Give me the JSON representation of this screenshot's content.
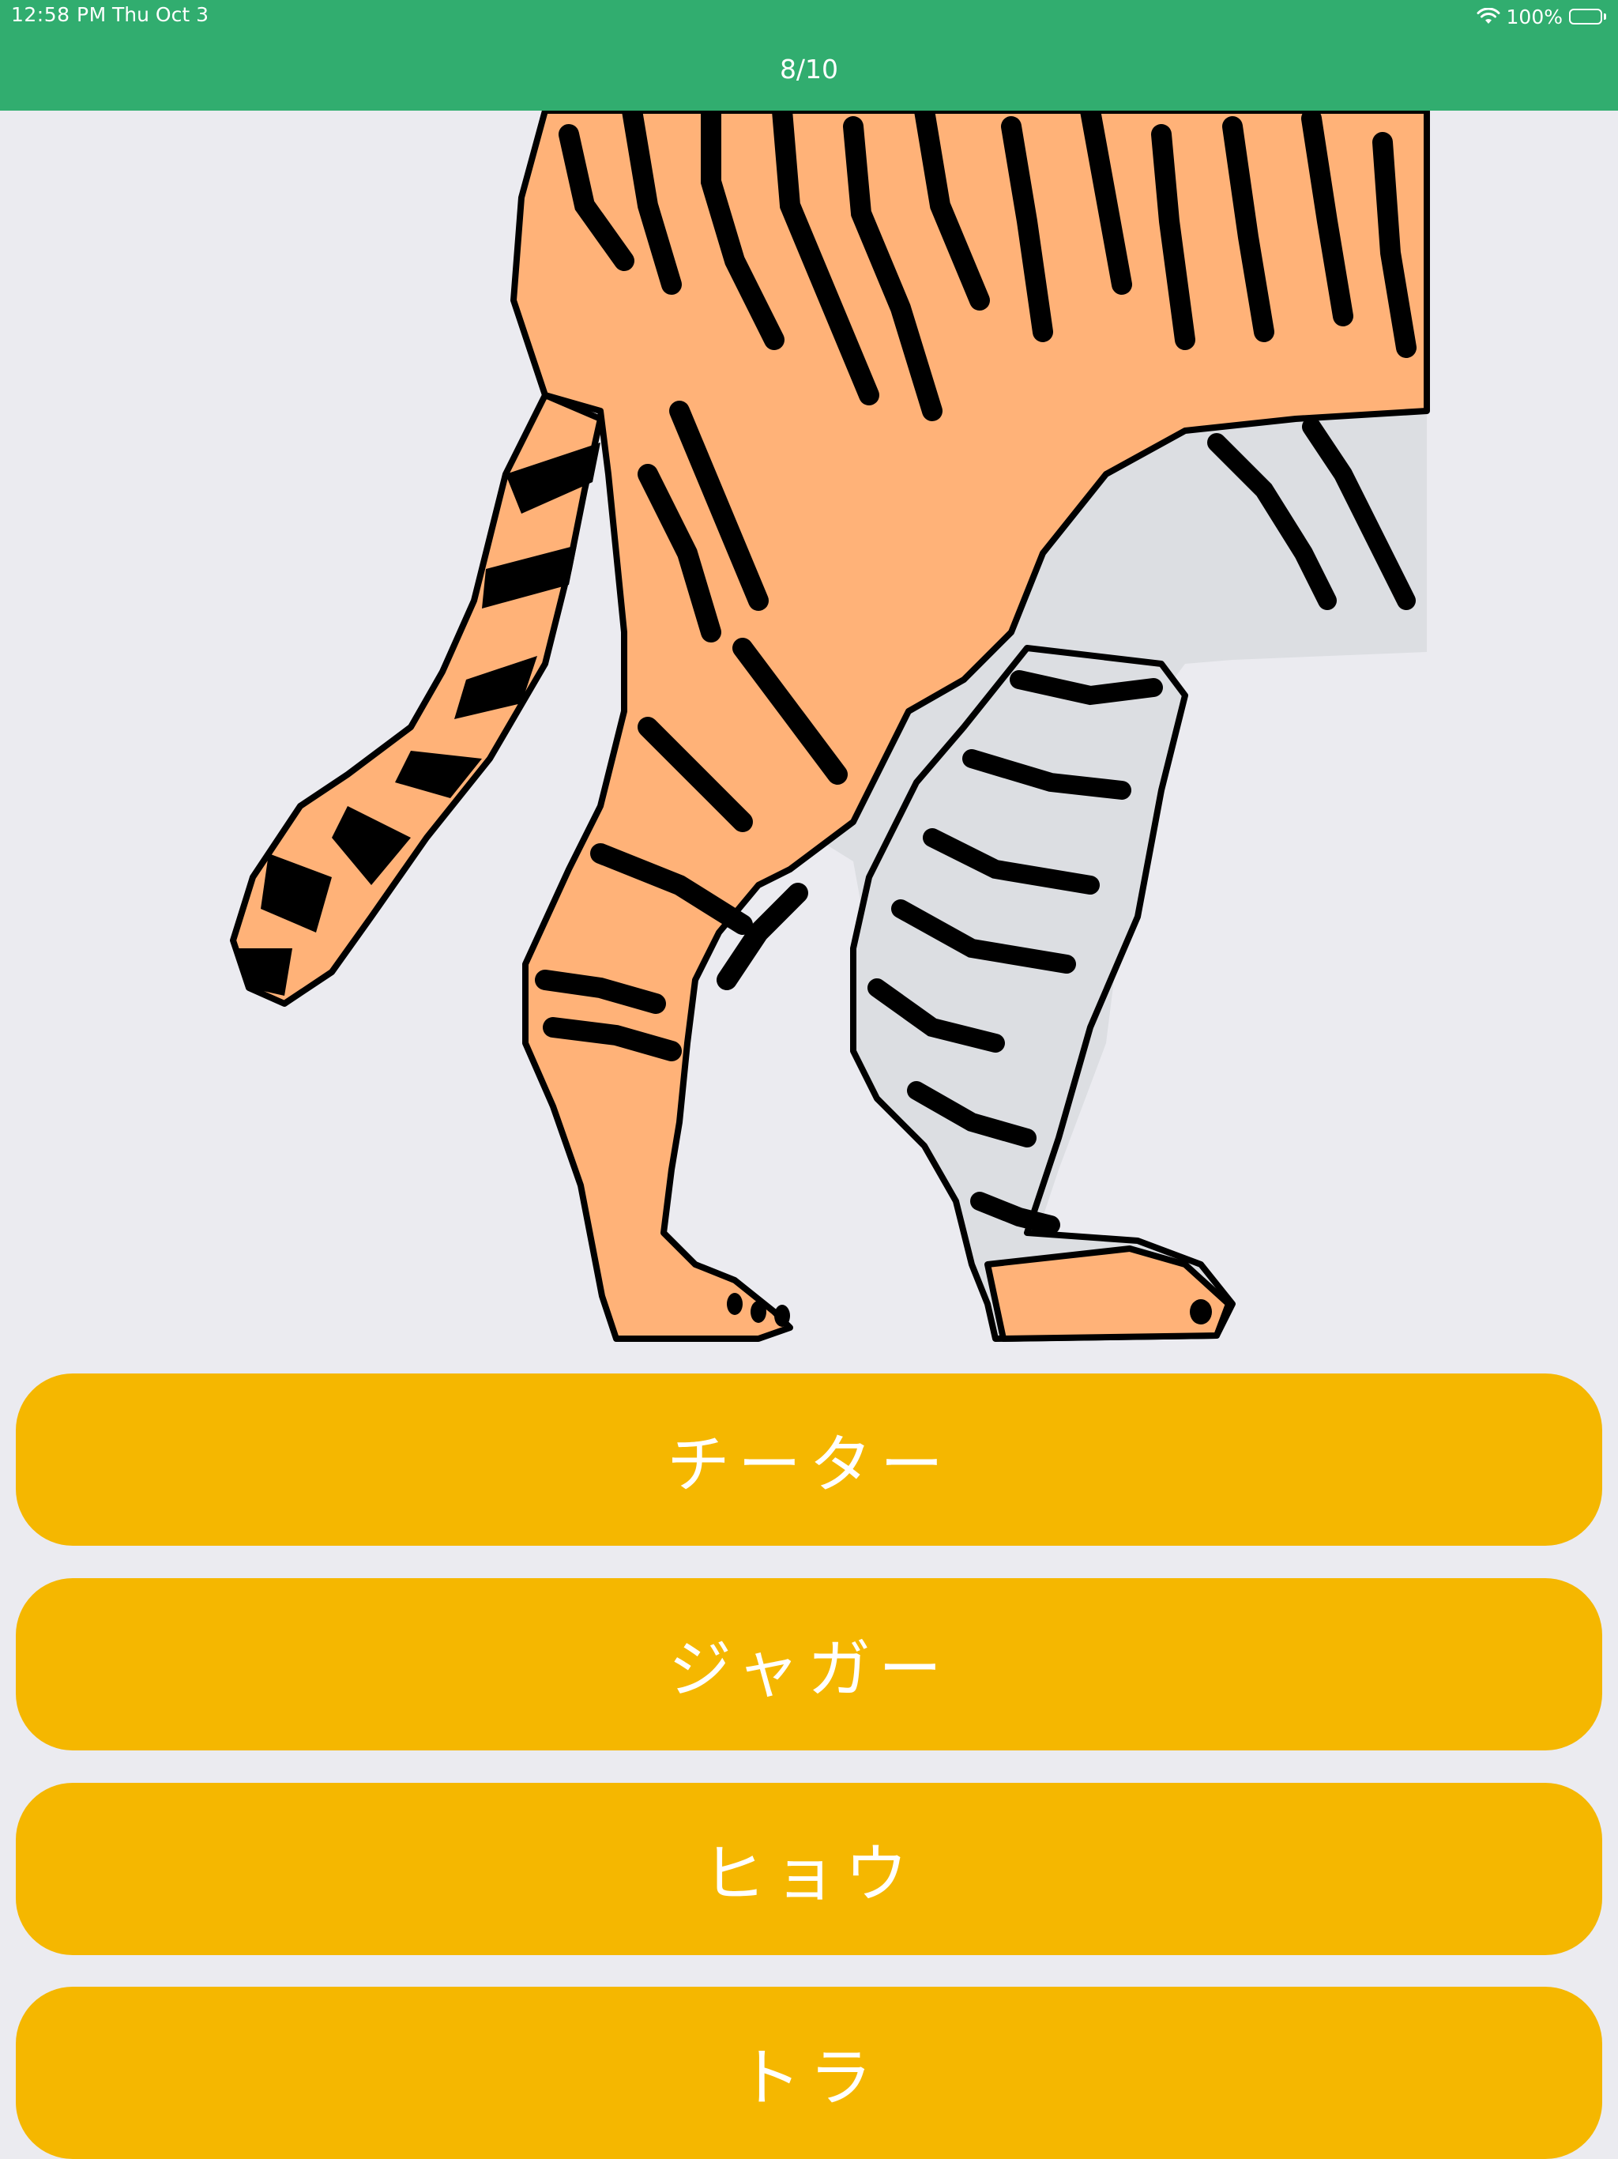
{
  "status_bar": {
    "time": "12:58 PM",
    "date": "Thu Oct 3",
    "battery": "100%",
    "battery_level": 1.0,
    "icons": [
      "wifi-icon",
      "battery-icon"
    ]
  },
  "header": {
    "progress": "8/10",
    "background_color": "#31AD6F"
  },
  "illustration": {
    "subject": "tiger",
    "colors": {
      "fur": "#FFB278",
      "belly": "#DCDEE2",
      "stripes": "#000000"
    }
  },
  "answers": [
    {
      "label": "チーター"
    },
    {
      "label": "ジャガー"
    },
    {
      "label": "ヒョウ"
    },
    {
      "label": "トラ"
    }
  ],
  "theme": {
    "button_color": "#F5B700",
    "background": "#EBEBF0"
  }
}
